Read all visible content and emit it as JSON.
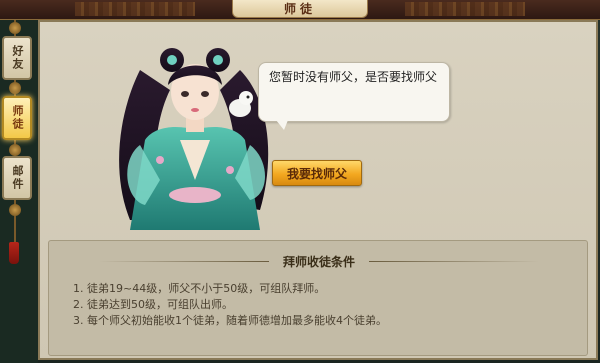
{
  "header": {
    "title": "师徒"
  },
  "tabs": [
    {
      "label": "好友",
      "active": false
    },
    {
      "label": "师徒",
      "active": true
    },
    {
      "label": "邮件",
      "active": false
    }
  ],
  "dialog": {
    "speech": "您暂时没有师父，是否要找师父"
  },
  "actions": {
    "find_master_label": "我要找师父"
  },
  "conditions": {
    "title": "拜师收徒条件",
    "rules": [
      "1. 徒弟19~44级，师父不小于50级，可组队拜师。",
      "2. 徒弟达到50级，可组队出师。",
      "3. 每个师父初始能收1个徒弟，随着师德增加最多能收4个徒弟。"
    ]
  },
  "colors": {
    "panel_bg": "#d9d2c0",
    "accent_button": "#f3a820",
    "active_tab": "#f3c948"
  }
}
